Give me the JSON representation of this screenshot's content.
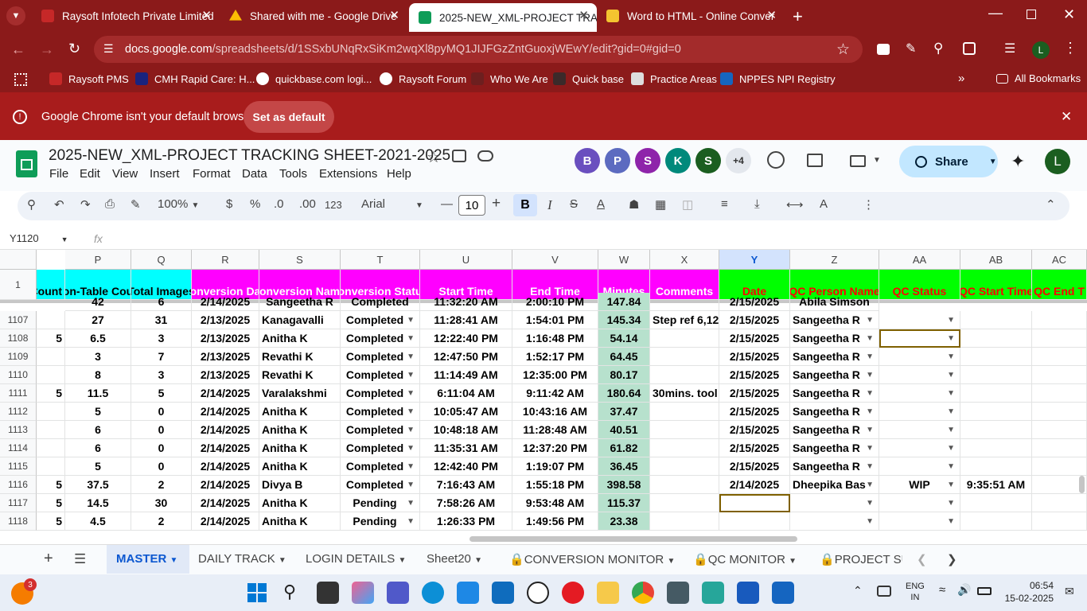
{
  "browser": {
    "tabs": [
      {
        "label": "Raysoft Infotech Private Limited",
        "color": "#c62828"
      },
      {
        "label": "Shared with me - Google Drive",
        "color": "#fbbc04"
      },
      {
        "label": "2025-NEW_XML-PROJECT TRAC",
        "color": "#0f9d58"
      },
      {
        "label": "Word to HTML - Online Conver",
        "color": "#5f2b0f"
      }
    ],
    "url_domain": "docs.google.com",
    "url_path": "/spreadsheets/d/1SSxbUNqRxSiKm2wqXl8pyMQ1JIJFGzZntGuoxjWEwY/edit?gid=0#gid=0",
    "bookmarks": [
      "Raysoft PMS",
      "CMH Rapid Care: H...",
      "quickbase.com logi...",
      "Raysoft Forum",
      "Who We Are",
      "Quick base",
      "Practice Areas",
      "NPPES NPI Registry"
    ],
    "all_bookmarks": "All Bookmarks",
    "profile_initial": "L"
  },
  "infobar": {
    "message": "Google Chrome isn't your default browser",
    "button": "Set as default"
  },
  "sheets": {
    "title": "2025-NEW_XML-PROJECT TRACKING SHEET-2021-2025",
    "menus": [
      "File",
      "Edit",
      "View",
      "Insert",
      "Format",
      "Data",
      "Tools",
      "Extensions",
      "Help"
    ],
    "avatars": [
      {
        "letter": "B",
        "color": "#6a4fbf"
      },
      {
        "letter": "P",
        "color": "#5c6bc0"
      },
      {
        "letter": "S",
        "color": "#8e24aa"
      },
      {
        "letter": "K",
        "color": "#00897b"
      },
      {
        "letter": "S",
        "color": "#1b5e20"
      }
    ],
    "more_avatars": "+4",
    "share": "Share",
    "profile": "L",
    "toolbar": {
      "zoom": "100%",
      "currency": "$",
      "percent": "%",
      "dec_less": ".0",
      "dec_more": ".00",
      "number_format": "123",
      "font": "Arial",
      "font_size": "10"
    },
    "name_box": "Y1120",
    "fx": "fx"
  },
  "columns": [
    "P",
    "Q",
    "R",
    "S",
    "T",
    "U",
    "V",
    "W",
    "X",
    "Y",
    "Z",
    "AA",
    "AB",
    "AC"
  ],
  "header_row": {
    "row": "1",
    "cells": [
      "Count",
      "on-Table Cou",
      "Total Images",
      "onversion Da",
      "onversion Nam",
      "onversion Statu",
      "Start Time",
      "End Time",
      "Minutes",
      "Comments",
      "Date",
      "QC Person Name",
      "QC Status",
      "QC Start Time",
      "QC End T"
    ]
  },
  "rows": [
    {
      "num": "1107",
      "c": [
        "",
        "27",
        "31",
        "2/13/2025",
        "Kanagavalli",
        "Completed",
        "11:28:41 AM",
        "1:54:01 PM",
        "145.34",
        "Step ref 6,12 r",
        "2/15/2025",
        "Sangeetha R",
        "",
        "",
        ""
      ]
    },
    {
      "num": "1108",
      "c": [
        "5",
        "6.5",
        "3",
        "2/13/2025",
        "Anitha K",
        "Completed",
        "12:22:40 PM",
        "1:16:48 PM",
        "54.14",
        "",
        "2/15/2025",
        "Sangeetha R",
        "",
        "",
        ""
      ]
    },
    {
      "num": "1109",
      "c": [
        "",
        "3",
        "7",
        "2/13/2025",
        "Revathi K",
        "Completed",
        "12:47:50 PM",
        "1:52:17 PM",
        "64.45",
        "",
        "2/15/2025",
        "Sangeetha R",
        "",
        "",
        ""
      ]
    },
    {
      "num": "1110",
      "c": [
        "",
        "8",
        "3",
        "2/13/2025",
        "Revathi K",
        "Completed",
        "11:14:49 AM",
        "12:35:00 PM",
        "80.17",
        "",
        "2/15/2025",
        "Sangeetha R",
        "",
        "",
        ""
      ]
    },
    {
      "num": "1111",
      "c": [
        "5",
        "11.5",
        "5",
        "2/14/2025",
        "Varalakshmi",
        "Completed",
        "6:11:04 AM",
        "9:11:42 AM",
        "180.64",
        "30mins. tool s",
        "2/15/2025",
        "Sangeetha R",
        "",
        "",
        ""
      ]
    },
    {
      "num": "1112",
      "c": [
        "",
        "5",
        "0",
        "2/14/2025",
        "Anitha K",
        "Completed",
        "10:05:47 AM",
        "10:43:16 AM",
        "37.47",
        "",
        "2/15/2025",
        "Sangeetha R",
        "",
        "",
        ""
      ]
    },
    {
      "num": "1113",
      "c": [
        "",
        "6",
        "0",
        "2/14/2025",
        "Anitha K",
        "Completed",
        "10:48:18 AM",
        "11:28:48 AM",
        "40.51",
        "",
        "2/15/2025",
        "Sangeetha R",
        "",
        "",
        ""
      ]
    },
    {
      "num": "1114",
      "c": [
        "",
        "6",
        "0",
        "2/14/2025",
        "Anitha K",
        "Completed",
        "11:35:31 AM",
        "12:37:20 PM",
        "61.82",
        "",
        "2/15/2025",
        "Sangeetha R",
        "",
        "",
        ""
      ]
    },
    {
      "num": "1115",
      "c": [
        "",
        "5",
        "0",
        "2/14/2025",
        "Anitha K",
        "Completed",
        "12:42:40 PM",
        "1:19:07 PM",
        "36.45",
        "",
        "2/15/2025",
        "Sangeetha R",
        "",
        "",
        ""
      ]
    },
    {
      "num": "1116",
      "c": [
        "5",
        "37.5",
        "2",
        "2/14/2025",
        "Divya B",
        "Completed",
        "7:16:43 AM",
        "1:55:18 PM",
        "398.58",
        "",
        "2/14/2025",
        "Dheepika Bas",
        "WIP",
        "9:35:51 AM",
        ""
      ]
    },
    {
      "num": "1117",
      "c": [
        "5",
        "14.5",
        "30",
        "2/14/2025",
        "Anitha K",
        "Pending",
        "7:58:26 AM",
        "9:53:48 AM",
        "115.37",
        "",
        "",
        "",
        "",
        "",
        ""
      ]
    },
    {
      "num": "1118",
      "c": [
        "5",
        "4.5",
        "2",
        "2/14/2025",
        "Anitha K",
        "Pending",
        "1:26:33 PM",
        "1:49:56 PM",
        "23.38",
        "",
        "",
        "",
        "",
        "",
        ""
      ]
    }
  ],
  "partial_row": {
    "c": [
      "42",
      "6",
      "2/14/2025",
      "Sangeetha R",
      "Completed",
      "11:32:20 AM",
      "2:00:10 PM",
      "147.84",
      "",
      "2/15/2025",
      "Abila Simson"
    ]
  },
  "sheet_tabs": [
    "MASTER",
    "DAILY TRACK",
    "LOGIN DETAILS",
    "Sheet20",
    "CONVERSION MONITOR",
    "QC MONITOR",
    "PROJECT SU"
  ],
  "taskbar": {
    "badge": "3",
    "lang1": "ENG",
    "lang2": "IN",
    "time": "06:54",
    "date": "15-02-2025"
  },
  "colors": {
    "chrome": "#8b1a1a",
    "infobar": "#a81c1c",
    "header_cyan": "#00ffff",
    "header_magenta": "#ff00ff",
    "header_green": "#00ff00",
    "minutes_green": "#b7e1cd",
    "header_red_text": "#ff0000"
  }
}
